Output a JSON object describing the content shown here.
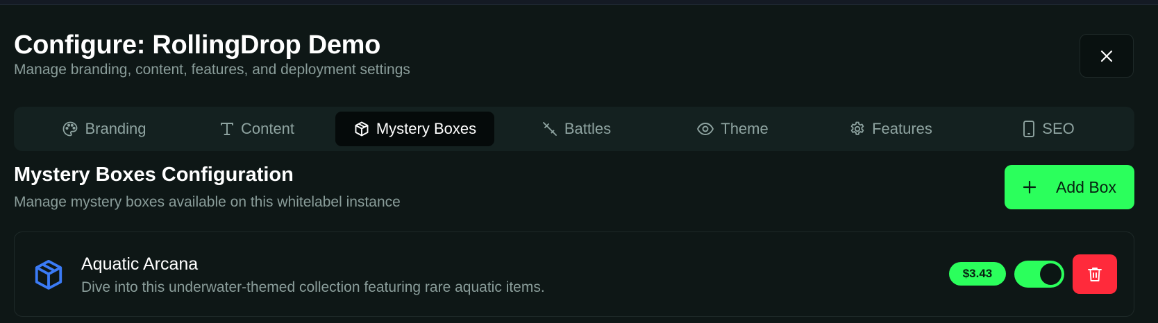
{
  "header": {
    "title": "Configure: RollingDrop Demo",
    "subtitle": "Manage branding, content, features, and deployment settings"
  },
  "close_icon": "close-icon",
  "tabs": [
    {
      "label": "Branding",
      "icon": "palette-icon",
      "active": false
    },
    {
      "label": "Content",
      "icon": "text-icon",
      "active": false
    },
    {
      "label": "Mystery Boxes",
      "icon": "box-icon",
      "active": true
    },
    {
      "label": "Battles",
      "icon": "sword-icon",
      "active": false
    },
    {
      "label": "Theme",
      "icon": "eye-icon",
      "active": false
    },
    {
      "label": "Features",
      "icon": "gear-icon",
      "active": false
    },
    {
      "label": "SEO",
      "icon": "smartphone-icon",
      "active": false
    }
  ],
  "section": {
    "title": "Mystery Boxes Configuration",
    "subtitle": "Manage mystery boxes available on this whitelabel instance",
    "add_label": "Add Box"
  },
  "boxes": [
    {
      "name": "Aquatic Arcana",
      "description": "Dive into this underwater-themed collection featuring rare aquatic items.",
      "price": "$3.43",
      "enabled": true
    }
  ],
  "colors": {
    "background": "#0e1716",
    "accent": "#2bff5c",
    "danger": "#ff2a3b",
    "box_icon": "#3b7bf6",
    "muted_text": "#8a9d9a"
  }
}
